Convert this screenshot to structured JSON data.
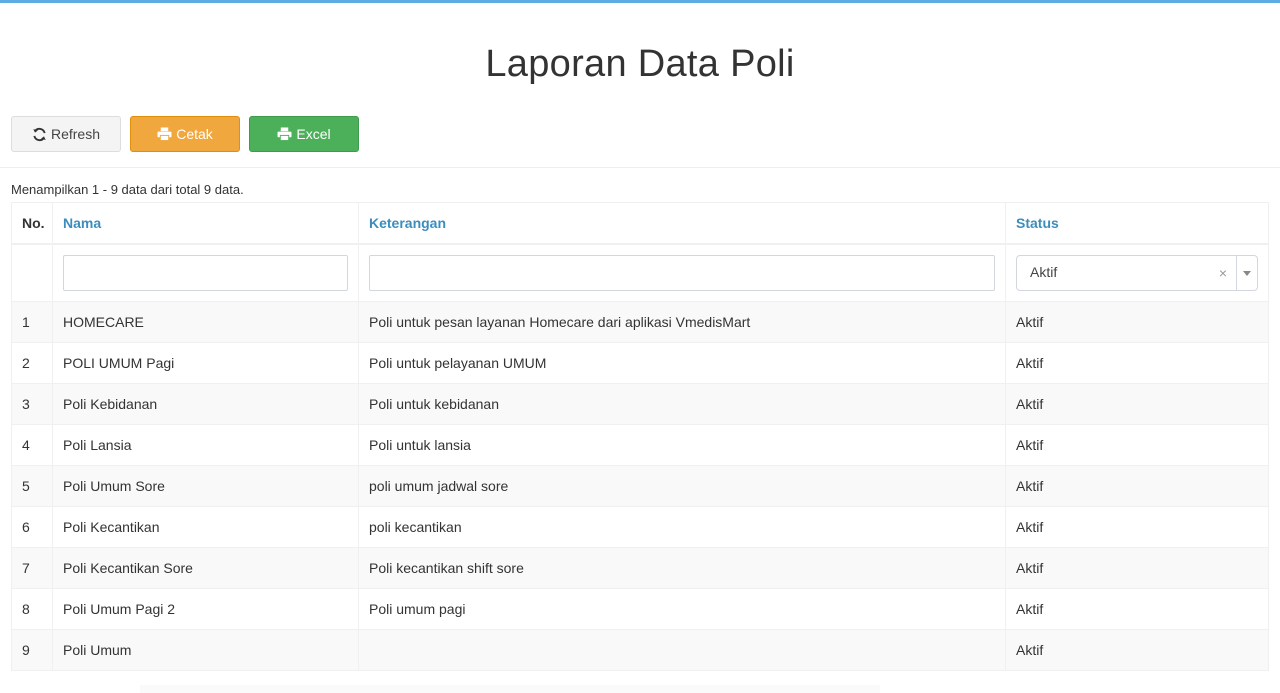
{
  "page": {
    "title": "Laporan Data Poli"
  },
  "toolbar": {
    "refresh_label": "Refresh",
    "print_label": "Cetak",
    "excel_label": "Excel",
    "colors": {
      "print": "#f0a73d",
      "excel": "#4caf59",
      "accent": "#3c8dbc"
    }
  },
  "summary": "Menampilkan 1 - 9 data dari total 9 data.",
  "table": {
    "headers": {
      "no": "No.",
      "nama": "Nama",
      "keterangan": "Keterangan",
      "status": "Status"
    },
    "filters": {
      "nama": "",
      "keterangan": "",
      "status": "Aktif",
      "status_clear": "×"
    },
    "rows": [
      {
        "no": "1",
        "nama": "HOMECARE",
        "keterangan": "Poli untuk pesan layanan Homecare dari aplikasi VmedisMart",
        "status": "Aktif"
      },
      {
        "no": "2",
        "nama": "POLI UMUM Pagi",
        "keterangan": "Poli untuk pelayanan UMUM",
        "status": "Aktif"
      },
      {
        "no": "3",
        "nama": "Poli Kebidanan",
        "keterangan": "Poli untuk kebidanan",
        "status": "Aktif"
      },
      {
        "no": "4",
        "nama": "Poli Lansia",
        "keterangan": "Poli untuk lansia",
        "status": "Aktif"
      },
      {
        "no": "5",
        "nama": "Poli Umum Sore",
        "keterangan": "poli umum jadwal sore",
        "status": "Aktif"
      },
      {
        "no": "6",
        "nama": "Poli Kecantikan",
        "keterangan": "poli kecantikan",
        "status": "Aktif"
      },
      {
        "no": "7",
        "nama": "Poli Kecantikan Sore",
        "keterangan": "Poli kecantikan shift sore",
        "status": "Aktif"
      },
      {
        "no": "8",
        "nama": "Poli Umum Pagi 2",
        "keterangan": "Poli umum pagi",
        "status": "Aktif"
      },
      {
        "no": "9",
        "nama": "Poli Umum",
        "keterangan": "",
        "status": "Aktif"
      }
    ]
  }
}
